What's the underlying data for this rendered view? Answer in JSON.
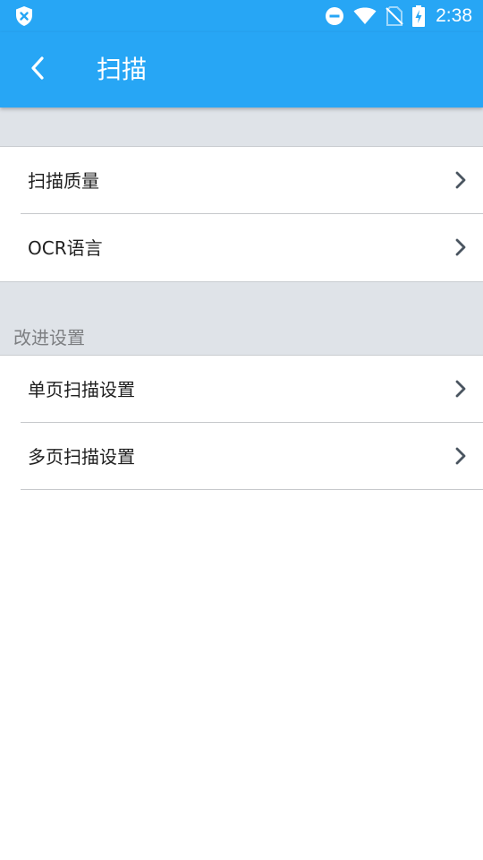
{
  "status_bar": {
    "time": "2:38",
    "icons": [
      "shield-x-icon",
      "do-not-disturb-icon",
      "wifi-icon",
      "no-sim-icon",
      "battery-charging-icon"
    ]
  },
  "toolbar": {
    "back_icon": "chevron-left-icon",
    "title": "扫描"
  },
  "groups": [
    {
      "header": "",
      "items": [
        {
          "label": "扫描质量",
          "icon": "chevron-right-icon"
        },
        {
          "label": "OCR语言",
          "icon": "chevron-right-icon"
        }
      ]
    },
    {
      "header": "改进设置",
      "items": [
        {
          "label": "单页扫描设置",
          "icon": "chevron-right-icon"
        },
        {
          "label": "多页扫描设置",
          "icon": "chevron-right-icon"
        }
      ]
    }
  ],
  "colors": {
    "accent": "#27a6f5",
    "section_background": "#dfe3e8",
    "chevron": "#4a5560"
  }
}
